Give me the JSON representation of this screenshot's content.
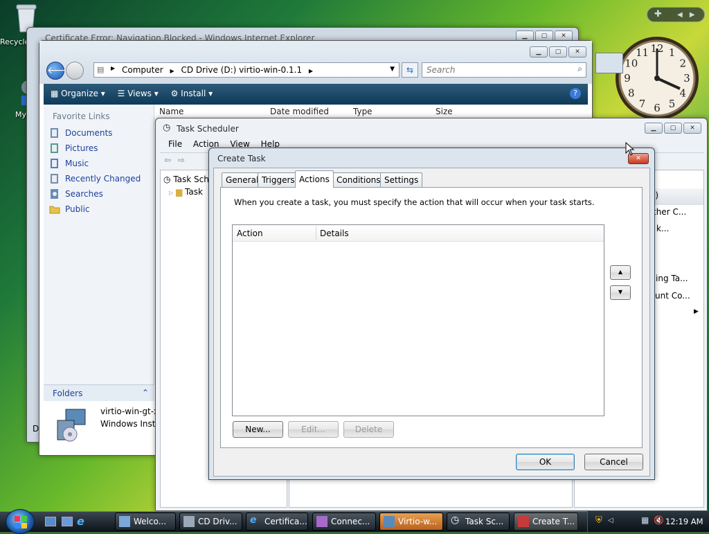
{
  "desktop": {
    "recycle_label": "Recycle",
    "my_label": "My"
  },
  "ie_window": {
    "title": "Certificate Error: Navigation Blocked - Windows Internet Explorer",
    "cut_letter": "D"
  },
  "explorer": {
    "breadcrumb": [
      "Computer",
      "CD Drive (D:) virtio-win-0.1.1"
    ],
    "search_placeholder": "Search",
    "toolbar": {
      "organize": "Organize",
      "views": "Views",
      "install": "Install"
    },
    "fav_title": "Favorite Links",
    "links": [
      "Documents",
      "Pictures",
      "Music",
      "Recently Changed",
      "Searches",
      "Public"
    ],
    "folders": "Folders",
    "columns": [
      "Name",
      "Date modified",
      "Type",
      "Size"
    ],
    "file_name": "virtio-win-gt-x",
    "file_type": "Windows Instal"
  },
  "scheduler": {
    "title": "Task Scheduler",
    "menu": [
      "File",
      "Action",
      "View",
      "Help"
    ],
    "tree": [
      "Task Sche",
      "Task"
    ],
    "right_items": [
      "l)",
      "ther C...",
      "k...",
      "ing Ta...",
      "unt Co..."
    ]
  },
  "create_task": {
    "title": "Create Task",
    "tabs": [
      "General",
      "Triggers",
      "Actions",
      "Conditions",
      "Settings"
    ],
    "selected_tab": "Actions",
    "description": "When you create a task, you must specify the action that will occur when your task starts.",
    "columns": [
      "Action",
      "Details"
    ],
    "buttons": {
      "new": "New...",
      "edit": "Edit...",
      "delete": "Delete",
      "ok": "OK",
      "cancel": "Cancel"
    }
  },
  "clock_numbers": [
    "12",
    "1",
    "2",
    "3",
    "4",
    "5",
    "6",
    "7",
    "8",
    "9",
    "10",
    "11"
  ],
  "taskbar": {
    "items": [
      "Welco...",
      "CD Driv...",
      "Certifica...",
      "Connec...",
      "Virtio-w...",
      "Task Sc...",
      "Create T..."
    ],
    "time": "12:19 AM"
  },
  "colors": {
    "taskbar": "#202830",
    "accent": "#3c7fb1",
    "link": "#1e3f9a"
  }
}
